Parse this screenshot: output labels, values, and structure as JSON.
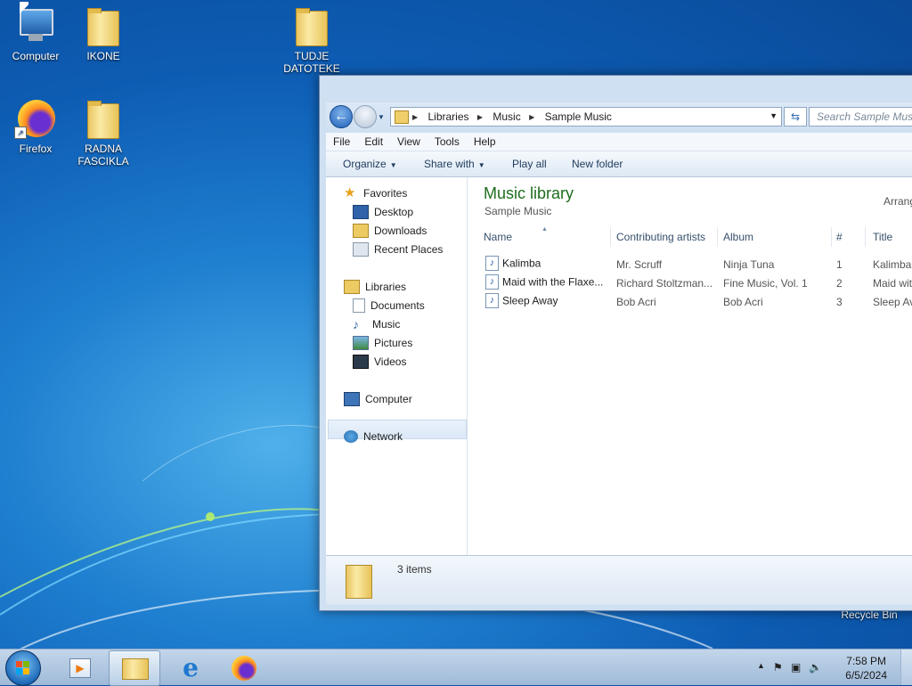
{
  "desktop": {
    "icons": [
      {
        "label": "Computer",
        "icon": "computer-icon"
      },
      {
        "label": "IKONE",
        "icon": "folder-icon"
      },
      {
        "label": "TUDJE DATOTEKE",
        "icon": "folder-icon"
      },
      {
        "label": "Firefox",
        "icon": "firefox-icon"
      },
      {
        "label": "RADNA FASCIKLA",
        "icon": "folder-icon"
      },
      {
        "label": "Recycle Bin",
        "icon": "recycle-bin-icon"
      }
    ]
  },
  "explorer": {
    "breadcrumb": [
      "Libraries",
      "Music",
      "Sample Music"
    ],
    "search_placeholder": "Search Sample Music",
    "menu": [
      "File",
      "Edit",
      "View",
      "Tools",
      "Help"
    ],
    "commands": {
      "organize": "Organize",
      "share": "Share with",
      "play": "Play all",
      "new_folder": "New folder"
    },
    "nav": {
      "favorites": "Favorites",
      "desktop": "Desktop",
      "downloads": "Downloads",
      "recent": "Recent Places",
      "libraries": "Libraries",
      "documents": "Documents",
      "music": "Music",
      "pictures": "Pictures",
      "videos": "Videos",
      "computer": "Computer",
      "network": "Network"
    },
    "library_title": "Music library",
    "library_subtitle": "Sample Music",
    "arrange_label": "Arrang",
    "columns": [
      "Name",
      "Contributing artists",
      "Album",
      "#",
      "Title"
    ],
    "rows": [
      {
        "name": "Kalimba",
        "artist": "Mr. Scruff",
        "album": "Ninja Tuna",
        "num": "1",
        "title": "Kalimba"
      },
      {
        "name": "Maid with the Flaxe...",
        "artist": "Richard Stoltzman...",
        "album": "Fine Music, Vol. 1",
        "num": "2",
        "title": "Maid wit"
      },
      {
        "name": "Sleep Away",
        "artist": "Bob Acri",
        "album": "Bob Acri",
        "num": "3",
        "title": "Sleep Av"
      }
    ],
    "item_count": "3 items"
  },
  "taskbar": {
    "time": "7:58 PM",
    "date": "6/5/2024"
  }
}
